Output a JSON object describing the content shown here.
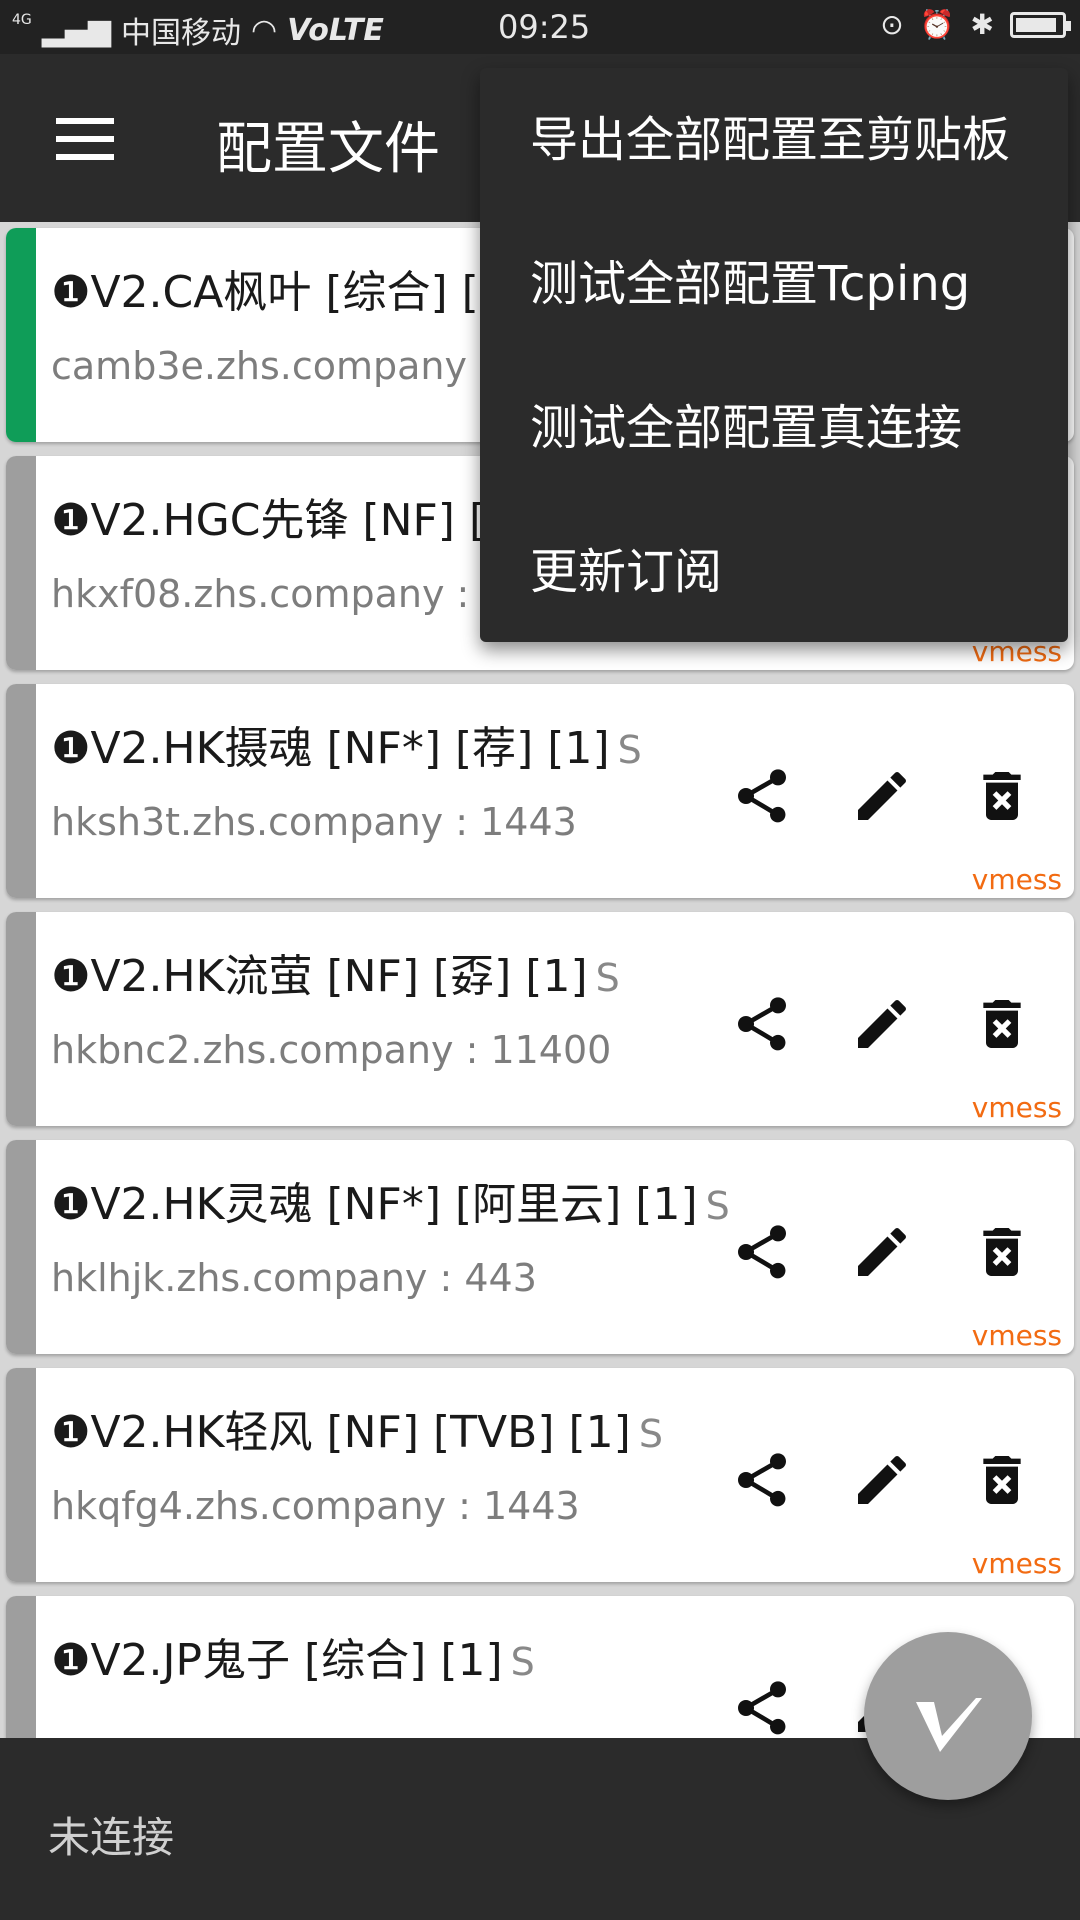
{
  "status_bar": {
    "network": "4G",
    "carrier": "中国移动",
    "volte": "VoLTE",
    "time": "09:25",
    "battery_level": 0.92
  },
  "app_bar": {
    "title": "配置文件"
  },
  "menu": {
    "items": [
      "导出全部配置至剪贴板",
      "测试全部配置Tcping",
      "测试全部配置真连接",
      "更新订阅"
    ]
  },
  "servers": [
    {
      "name": "❶V2.CA枫叶 [综合] [",
      "suffix": "",
      "address": "camb3e.zhs.company : ",
      "type": "",
      "selected": true
    },
    {
      "name": "❶V2.HGC先锋 [NF] [",
      "suffix": "",
      "address": "hkxf08.zhs.company : 1",
      "type": "vmess",
      "selected": false
    },
    {
      "name": "❶V2.HK摄魂 [NF*] [荐] [1]",
      "suffix": "S",
      "address": "hksh3t.zhs.company : 1443",
      "type": "vmess",
      "selected": false
    },
    {
      "name": "❶V2.HK流萤 [NF] [孬] [1]",
      "suffix": "S",
      "address": "hkbnc2.zhs.company : 11400",
      "type": "vmess",
      "selected": false
    },
    {
      "name": "❶V2.HK灵魂 [NF*] [阿里云] [1]",
      "suffix": "S",
      "address": "hklhjk.zhs.company : 443",
      "type": "vmess",
      "selected": false
    },
    {
      "name": "❶V2.HK轻风 [NF] [TVB] [1]",
      "suffix": "S",
      "address": "hkqfg4.zhs.company : 1443",
      "type": "vmess",
      "selected": false
    },
    {
      "name": "❶V2.JP鬼子 [综合] [1]",
      "suffix": "S",
      "address": "",
      "type": "",
      "selected": false
    }
  ],
  "bottom_bar": {
    "status": "未连接"
  },
  "colors": {
    "selected_stripe": "#0f9d58",
    "stripe": "#9e9e9e",
    "protocol": "#f26b12",
    "app_bar": "#2b2b2b"
  }
}
